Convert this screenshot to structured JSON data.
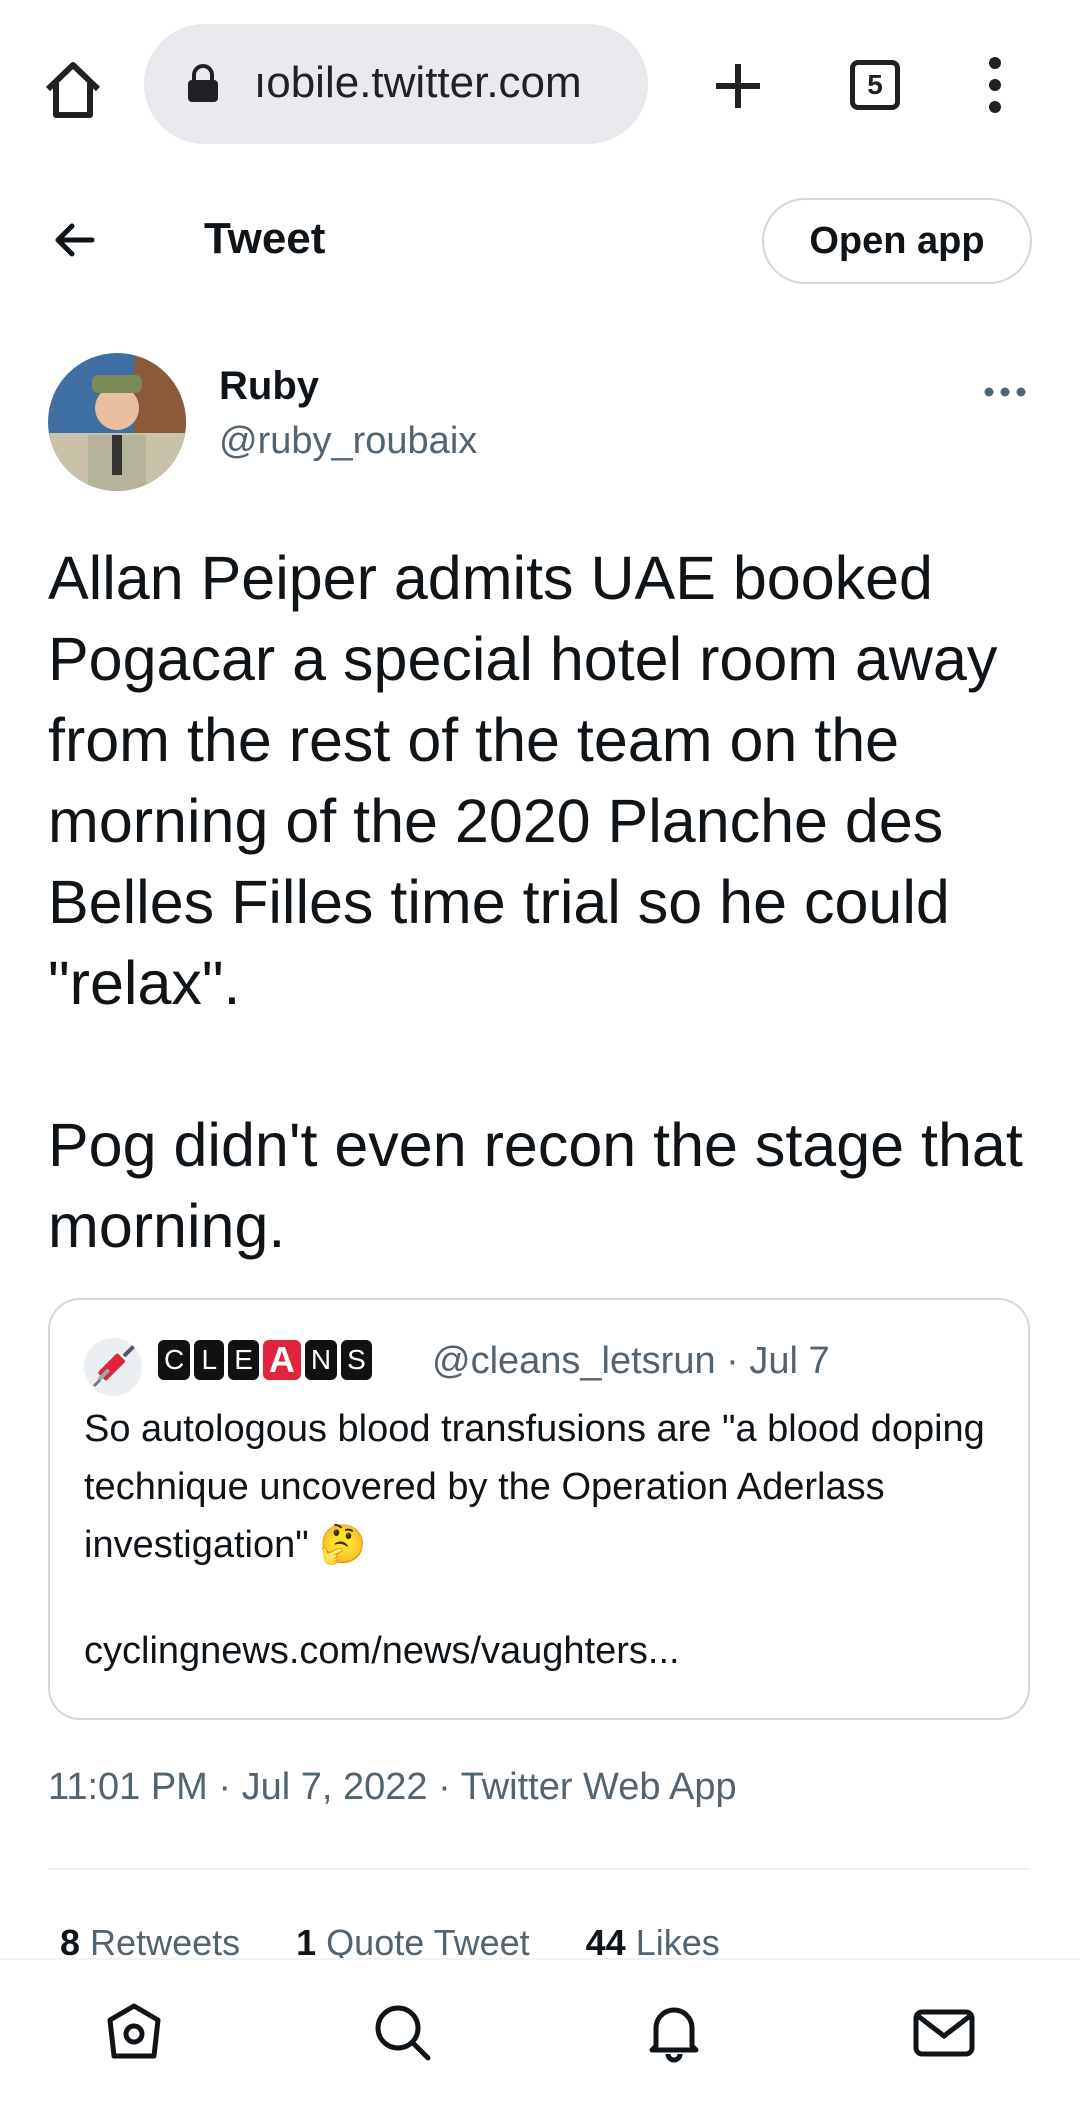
{
  "browser": {
    "url": "ıobile.twitter.com",
    "tab_count": "5"
  },
  "header": {
    "title": "Tweet",
    "open_app_label": "Open app"
  },
  "tweet": {
    "author_name": "Ruby",
    "author_handle": "@ruby_roubaix",
    "text_p1": "Allan Peiper admits UAE booked Pogacar a special hotel room away from the rest of the team on the morning of the 2020 Planche des Belles Filles time trial so he could \"relax\".",
    "text_p2": "Pog didn't even recon the stage that morning.",
    "timestamp": "11:01 PM · Jul 7, 2022 · Twitter Web App"
  },
  "quote": {
    "badges": [
      "C",
      "L",
      "E",
      "A",
      "N",
      "S"
    ],
    "handle_date": "@cleans_letsrun · Jul 7",
    "text": "So autologous blood transfusions are \"a blood doping technique uncovered by the Operation Aderlass investigation\" 🤔",
    "link": "cyclingnews.com/news/vaughters..."
  },
  "stats": {
    "retweets_count": "8",
    "retweets_label": "Retweets",
    "quotes_count": "1",
    "quotes_label": "Quote Tweet",
    "likes_count": "44",
    "likes_label": "Likes"
  },
  "colors": {
    "accent_red": "#e0243b",
    "secondary_text": "#536471",
    "border": "#cfd9de"
  }
}
